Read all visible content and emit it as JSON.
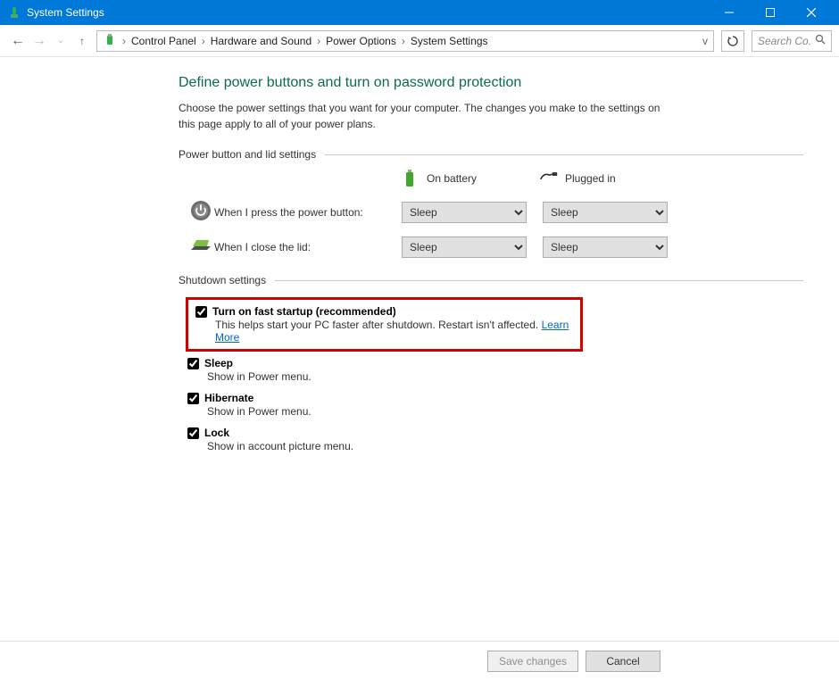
{
  "window": {
    "title": "System Settings"
  },
  "breadcrumb": {
    "items": [
      "Control Panel",
      "Hardware and Sound",
      "Power Options",
      "System Settings"
    ]
  },
  "search": {
    "placeholder": "Search Co..."
  },
  "main": {
    "heading": "Define power buttons and turn on password protection",
    "description": "Choose the power settings that you want for your computer. The changes you make to the settings on this page apply to all of your power plans.",
    "section_power": "Power button and lid settings",
    "col_battery": "On battery",
    "col_plugged": "Plugged in",
    "row_power": "When I press the power button:",
    "row_lid": "When I close the lid:",
    "combo_options": [
      "Sleep"
    ],
    "combo_power_bat": "Sleep",
    "combo_power_plug": "Sleep",
    "combo_lid_bat": "Sleep",
    "combo_lid_plug": "Sleep",
    "section_shutdown": "Shutdown settings",
    "sd": [
      {
        "label": "Turn on fast startup (recommended)",
        "sub": "This helps start your PC faster after shutdown. Restart isn't affected. ",
        "link": "Learn More",
        "checked": true
      },
      {
        "label": "Sleep",
        "sub": "Show in Power menu.",
        "checked": true
      },
      {
        "label": "Hibernate",
        "sub": "Show in Power menu.",
        "checked": true
      },
      {
        "label": "Lock",
        "sub": "Show in account picture menu.",
        "checked": true
      }
    ]
  },
  "footer": {
    "save": "Save changes",
    "cancel": "Cancel"
  }
}
